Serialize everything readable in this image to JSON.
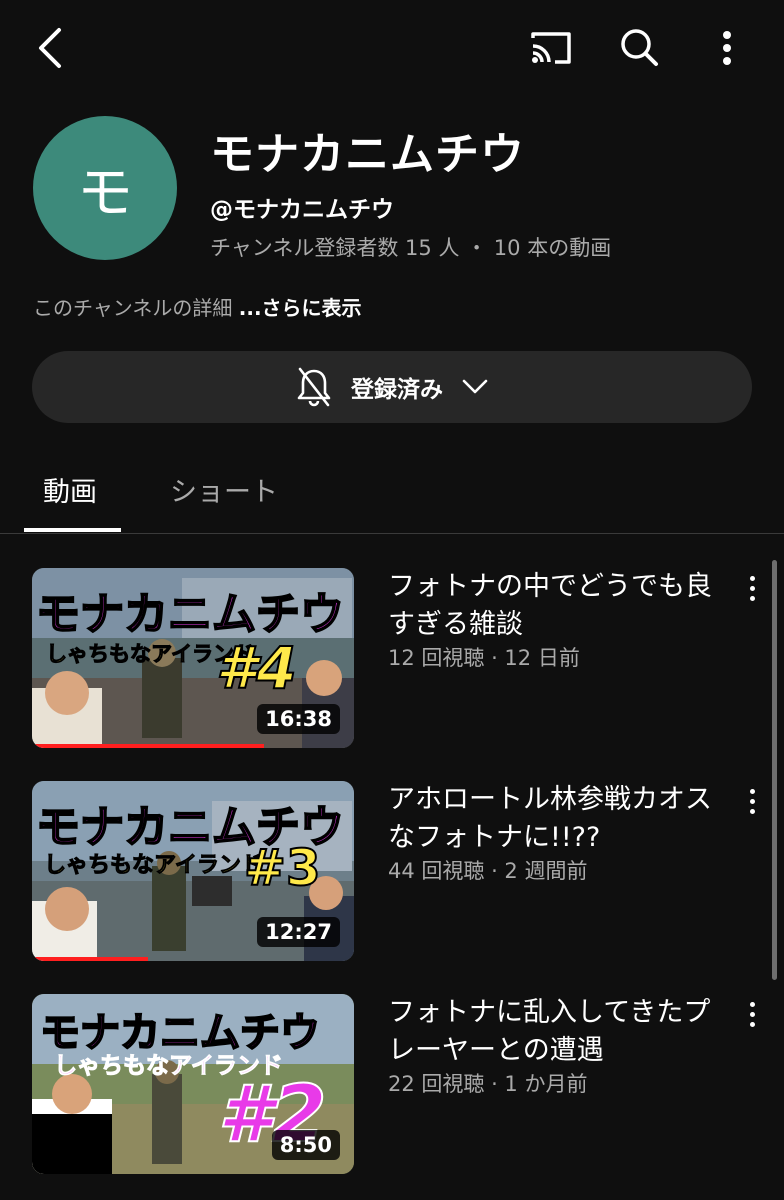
{
  "topbar": {
    "back_icon": "back-arrow-icon",
    "cast_icon": "cast-icon",
    "search_icon": "search-icon",
    "more_icon": "more-vert-icon"
  },
  "channel": {
    "avatar_letter": "モ",
    "avatar_color": "#3d8a7b",
    "name": "モナカニムチウ",
    "handle": "@モナカニムチウ",
    "stats": "チャンネル登録者数 15 人 ・ 10 本の動画",
    "description": "このチャンネルの詳細 ",
    "more_label": "...さらに表示"
  },
  "subscribe": {
    "icon": "bell-off-icon",
    "label": "登録済み",
    "chevron_icon": "chevron-down-icon"
  },
  "tabs": [
    {
      "label": "動画",
      "active": true
    },
    {
      "label": "ショート",
      "active": false
    }
  ],
  "videos": [
    {
      "thumb_title": "モナカニムチウ",
      "thumb_subtitle": "しゃちもなアイランド",
      "thumb_number": "#4",
      "duration": "16:38",
      "title": "フォトナの中でどうでも良すぎる雑談",
      "meta": "12 回視聴 · 12 日前",
      "watched_fraction": 0.72
    },
    {
      "thumb_title": "モナカニムチウ",
      "thumb_subtitle": "しゃちもなアイランド",
      "thumb_number": "#3",
      "duration": "12:27",
      "title": "アホロートル林参戦カオスなフォトナに!!??",
      "meta": "44 回視聴 · 2 週間前",
      "watched_fraction": 0.36
    },
    {
      "thumb_title": "モナカニムチウ",
      "thumb_subtitle": "しゃちもなアイランド",
      "thumb_number": "#2",
      "duration": "8:50",
      "title": "フォトナに乱入してきたプレーヤーとの遭遇",
      "meta": "22 回視聴 · 1 か月前",
      "watched_fraction": 0
    }
  ],
  "colors": {
    "background": "#0f0f0f",
    "accent_pink": "#e83ae8",
    "accent_yellow": "#ffe94a",
    "progress_red": "#ff1f1f"
  }
}
